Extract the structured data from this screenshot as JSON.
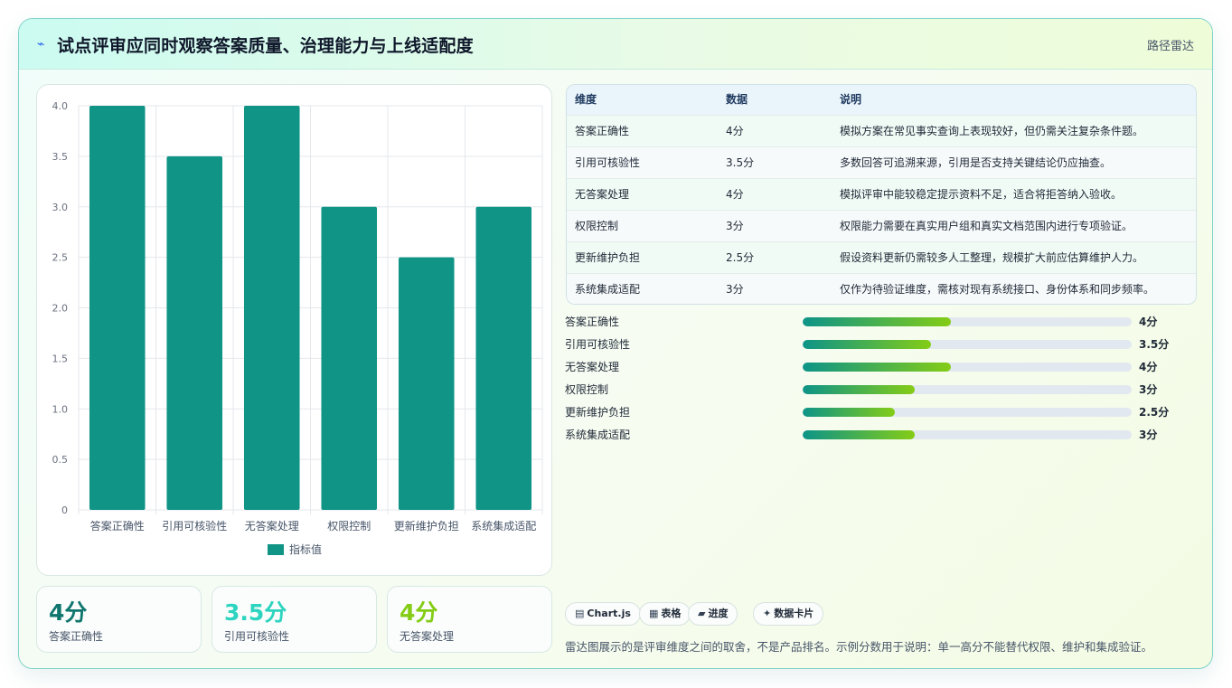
{
  "header": {
    "icon": "lightning-icon",
    "title": "试点评审应同时观察答案质量、治理能力与上线适配度",
    "right_link": "路径雷达"
  },
  "chart_data": {
    "type": "bar",
    "categories": [
      "答案正确性",
      "引用可核验性",
      "无答案处理",
      "权限控制",
      "更新维护负担",
      "系统集成适配"
    ],
    "series": [
      {
        "name": "指标值",
        "values": [
          4,
          3.5,
          4,
          3,
          2.5,
          3
        ],
        "color": "#0f9486"
      }
    ],
    "ylim": [
      0,
      4
    ],
    "yticks": [
      "4.0",
      "3.5",
      "3.0",
      "2.5",
      "2.0",
      "1.5",
      "1.0",
      "0.5",
      "0"
    ],
    "grid": true,
    "legend": "bottom"
  },
  "stats": [
    {
      "value": "4分",
      "label": "答案正确性",
      "color": "#0f766e"
    },
    {
      "value": "3.5分",
      "label": "引用可核验性",
      "color": "#2dd4bf"
    },
    {
      "value": "4分",
      "label": "无答案处理",
      "color": "#84cc16"
    }
  ],
  "table": {
    "headers": [
      "维度",
      "数据",
      "说明"
    ],
    "rows": [
      [
        "答案正确性",
        "4分",
        "模拟方案在常见事实查询上表现较好，但仍需关注复杂条件题。"
      ],
      [
        "引用可核验性",
        "3.5分",
        "多数回答可追溯来源，引用是否支持关键结论仍应抽查。"
      ],
      [
        "无答案处理",
        "4分",
        "模拟评审中能较稳定提示资料不足，适合将拒答纳入验收。"
      ],
      [
        "权限控制",
        "3分",
        "权限能力需要在真实用户组和真实文档范围内进行专项验证。"
      ],
      [
        "更新维护负担",
        "2.5分",
        "假设资料更新仍需较多人工整理，规模扩大前应估算维护人力。"
      ],
      [
        "系统集成适配",
        "3分",
        "仅作为待验证维度，需核对现有系统接口、身份体系和同步频率。"
      ]
    ]
  },
  "progress": [
    {
      "label": "答案正确性",
      "score": "4分",
      "fraction": 0.45
    },
    {
      "label": "引用可核验性",
      "score": "3.5分",
      "fraction": 0.39
    },
    {
      "label": "无答案处理",
      "score": "4分",
      "fraction": 0.45
    },
    {
      "label": "权限控制",
      "score": "3分",
      "fraction": 0.34
    },
    {
      "label": "更新维护负担",
      "score": "2.5分",
      "fraction": 0.28
    },
    {
      "label": "系统集成适配",
      "score": "3分",
      "fraction": 0.34
    }
  ],
  "pills": [
    {
      "icon": "chart-icon",
      "glyph": "▤",
      "label": "Chart.js"
    },
    {
      "icon": "table-icon",
      "glyph": "▦",
      "label": "表格"
    },
    {
      "icon": "progress-icon",
      "glyph": "▰",
      "label": "进度"
    },
    {
      "icon": "sparkle-icon",
      "glyph": "✦",
      "label": "数据卡片"
    }
  ],
  "footnote": "雷达图展示的是评审维度之间的取舍，不是产品排名。示例分数用于说明：单一高分不能替代权限、维护和集成验证。"
}
